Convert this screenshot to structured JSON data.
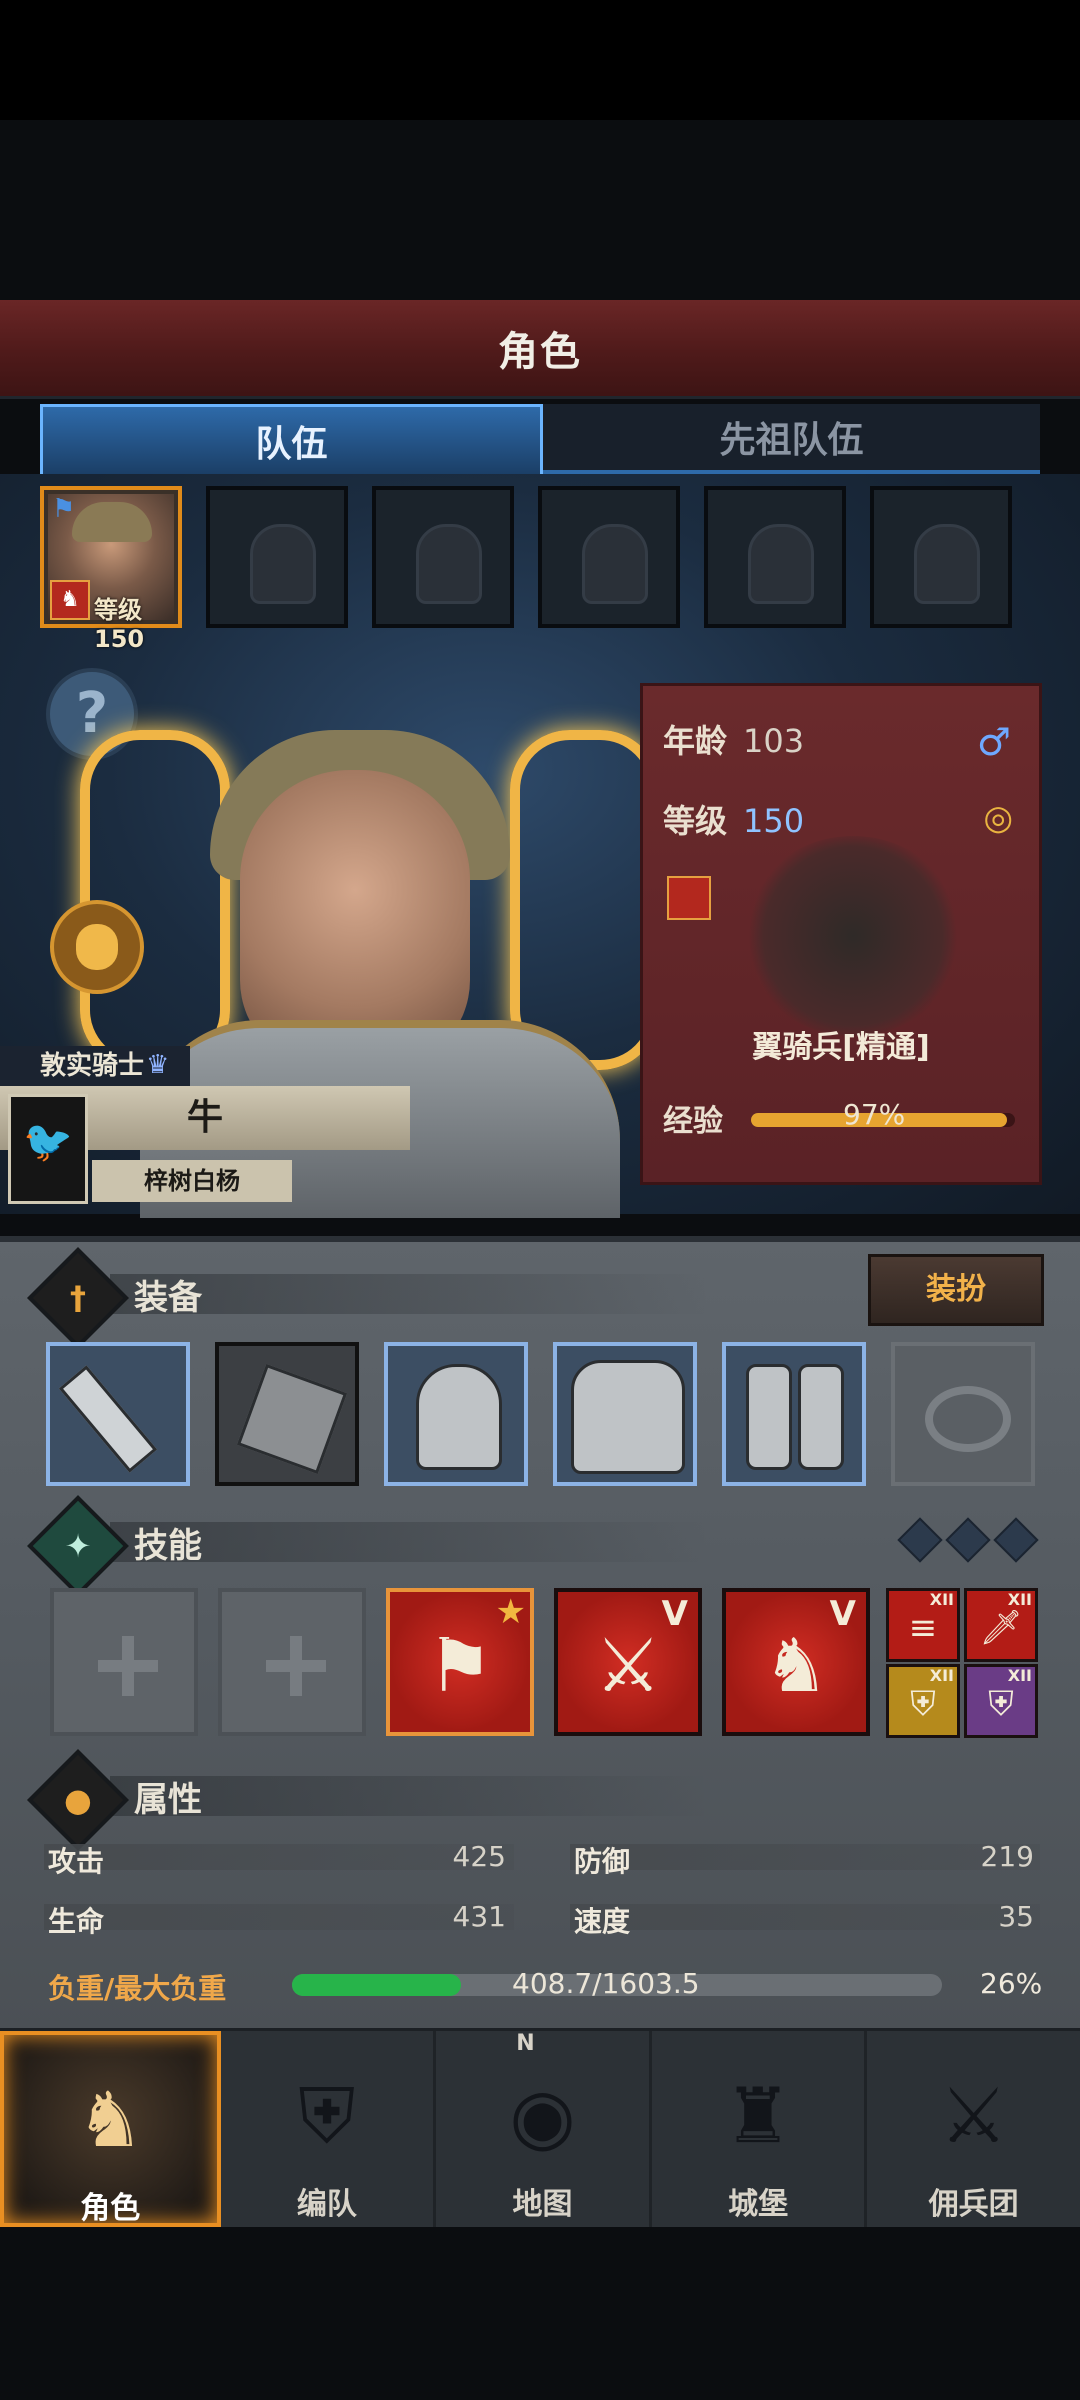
{
  "header": {
    "title": "角色"
  },
  "tabs": [
    {
      "label": "队伍"
    },
    {
      "label": "先祖队伍"
    }
  ],
  "party": {
    "selected_level": "等级150"
  },
  "hero": {
    "rank": "敦实骑士",
    "name": "牛",
    "origin": "梓树白杨"
  },
  "unit_card": {
    "age_label": "年龄",
    "age_value": "103",
    "level_label": "等级",
    "level_value": "150",
    "unit_name": "翼骑兵[精通]",
    "exp_label": "经验",
    "exp_percent": "97%",
    "exp_fraction": 0.97
  },
  "equipment": {
    "title": "装备",
    "dress_button": "装扮"
  },
  "skills": {
    "title": "技能"
  },
  "attributes": {
    "title": "属性",
    "attack_label": "攻击",
    "attack_value": "425",
    "defense_label": "防御",
    "defense_value": "219",
    "health_label": "生命",
    "health_value": "431",
    "speed_label": "速度",
    "speed_value": "35",
    "load_label": "负重/最大负重",
    "load_value": "408.7/1603.5",
    "load_percent": "26%",
    "load_fraction": 0.26
  },
  "nav": [
    {
      "label": "角色",
      "icon": "knight-icon"
    },
    {
      "label": "编队",
      "icon": "formation-icon"
    },
    {
      "label": "地图",
      "icon": "compass-map-icon"
    },
    {
      "label": "城堡",
      "icon": "castle-icon"
    },
    {
      "label": "佣兵团",
      "icon": "mercenary-icon"
    }
  ],
  "colors": {
    "accent_orange": "#e98f22",
    "tab_blue": "#2e6aa9",
    "load_green": "#27b44a"
  }
}
